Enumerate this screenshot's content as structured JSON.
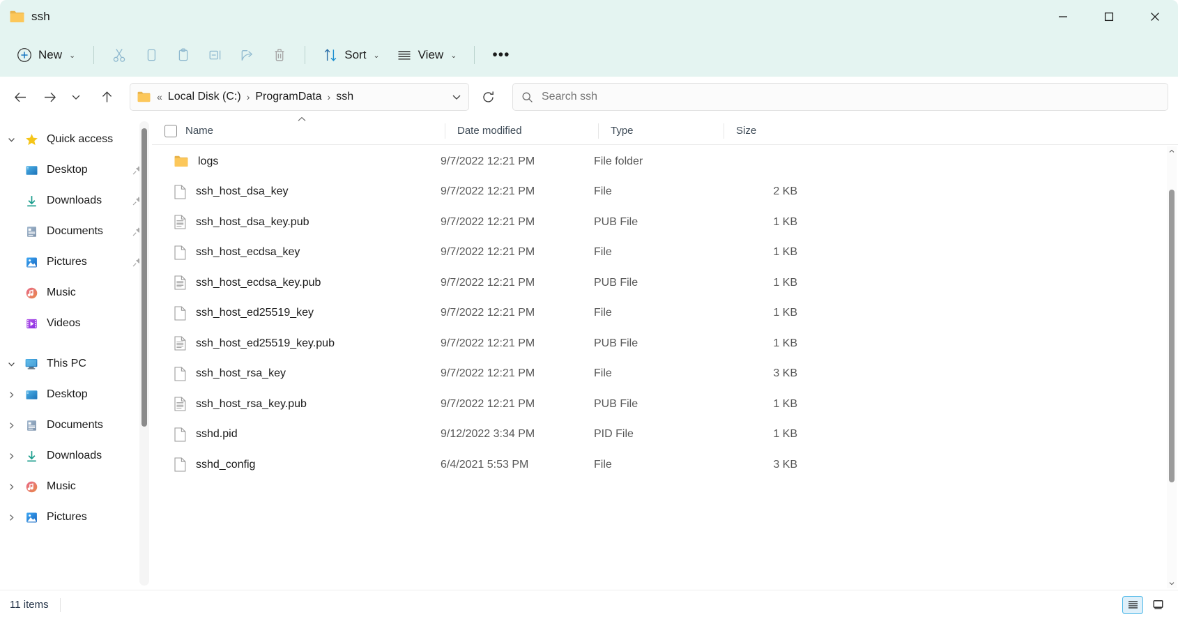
{
  "window": {
    "title": "ssh",
    "folder_icon": "folder-icon",
    "controls": {
      "minimize": "minimize-icon",
      "maximize": "maximize-icon",
      "close": "close-icon"
    }
  },
  "toolbar": {
    "new_label": "New",
    "sort_label": "Sort",
    "view_label": "View",
    "more_label": "•••",
    "icons": [
      "cut-icon",
      "copy-icon",
      "paste-icon",
      "rename-icon",
      "share-icon",
      "delete-icon"
    ]
  },
  "addressbar": {
    "back": "back-arrow-icon",
    "forward": "forward-arrow-icon",
    "recent": "chevron-down-icon",
    "up": "up-arrow-icon",
    "refresh": "refresh-icon",
    "breadcrumb_prefix": "«",
    "crumbs": [
      "Local Disk (C:)",
      "ProgramData",
      "ssh"
    ],
    "separator": "›"
  },
  "search": {
    "placeholder": "Search ssh",
    "value": "",
    "icon": "search-icon"
  },
  "sidebar": {
    "sections": [
      {
        "header": {
          "label": "Quick access",
          "icon": "star-icon",
          "expanded": true
        },
        "items": [
          {
            "label": "Desktop",
            "icon": "desktop-icon",
            "pinned": true
          },
          {
            "label": "Downloads",
            "icon": "downloads-icon",
            "pinned": true
          },
          {
            "label": "Documents",
            "icon": "documents-icon",
            "pinned": true
          },
          {
            "label": "Pictures",
            "icon": "pictures-icon",
            "pinned": true
          },
          {
            "label": "Music",
            "icon": "music-icon",
            "pinned": false
          },
          {
            "label": "Videos",
            "icon": "videos-icon",
            "pinned": false
          }
        ]
      },
      {
        "header": {
          "label": "This PC",
          "icon": "thispc-icon",
          "expanded": true
        },
        "items": [
          {
            "label": "Desktop",
            "icon": "desktop-icon",
            "expandable": true
          },
          {
            "label": "Documents",
            "icon": "documents-icon",
            "expandable": true
          },
          {
            "label": "Downloads",
            "icon": "downloads-icon",
            "expandable": true
          },
          {
            "label": "Music",
            "icon": "music-icon",
            "expandable": true
          },
          {
            "label": "Pictures",
            "icon": "pictures-icon",
            "expandable": true
          }
        ]
      }
    ]
  },
  "filelist": {
    "columns": {
      "name": "Name",
      "date": "Date modified",
      "type": "Type",
      "size": "Size"
    },
    "sort": {
      "column": "Name",
      "direction": "ascending",
      "caret": "ⱏ"
    },
    "rows": [
      {
        "name": "logs",
        "date": "9/7/2022 12:21 PM",
        "type": "File folder",
        "size": "",
        "icon": "folder-icon"
      },
      {
        "name": "ssh_host_dsa_key",
        "date": "9/7/2022 12:21 PM",
        "type": "File",
        "size": "2 KB",
        "icon": "file-icon"
      },
      {
        "name": "ssh_host_dsa_key.pub",
        "date": "9/7/2022 12:21 PM",
        "type": "PUB File",
        "size": "1 KB",
        "icon": "text-file-icon"
      },
      {
        "name": "ssh_host_ecdsa_key",
        "date": "9/7/2022 12:21 PM",
        "type": "File",
        "size": "1 KB",
        "icon": "file-icon"
      },
      {
        "name": "ssh_host_ecdsa_key.pub",
        "date": "9/7/2022 12:21 PM",
        "type": "PUB File",
        "size": "1 KB",
        "icon": "text-file-icon"
      },
      {
        "name": "ssh_host_ed25519_key",
        "date": "9/7/2022 12:21 PM",
        "type": "File",
        "size": "1 KB",
        "icon": "file-icon"
      },
      {
        "name": "ssh_host_ed25519_key.pub",
        "date": "9/7/2022 12:21 PM",
        "type": "PUB File",
        "size": "1 KB",
        "icon": "text-file-icon"
      },
      {
        "name": "ssh_host_rsa_key",
        "date": "9/7/2022 12:21 PM",
        "type": "File",
        "size": "3 KB",
        "icon": "file-icon"
      },
      {
        "name": "ssh_host_rsa_key.pub",
        "date": "9/7/2022 12:21 PM",
        "type": "PUB File",
        "size": "1 KB",
        "icon": "text-file-icon"
      },
      {
        "name": "sshd.pid",
        "date": "9/12/2022 3:34 PM",
        "type": "PID File",
        "size": "1 KB",
        "icon": "file-icon"
      },
      {
        "name": "sshd_config",
        "date": "6/4/2021 5:53 PM",
        "type": "File",
        "size": "3 KB",
        "icon": "file-icon"
      }
    ]
  },
  "status": {
    "item_count": "11 items",
    "details_view": "details-view-icon",
    "large_icons_view": "large-icons-view-icon"
  },
  "colors": {
    "titlebar_bg": "#e4f4f1",
    "accent": "#4db8e8",
    "folder_yellow": "#fcc75a",
    "text": "#1b1b1b",
    "muted_text": "#585858"
  }
}
